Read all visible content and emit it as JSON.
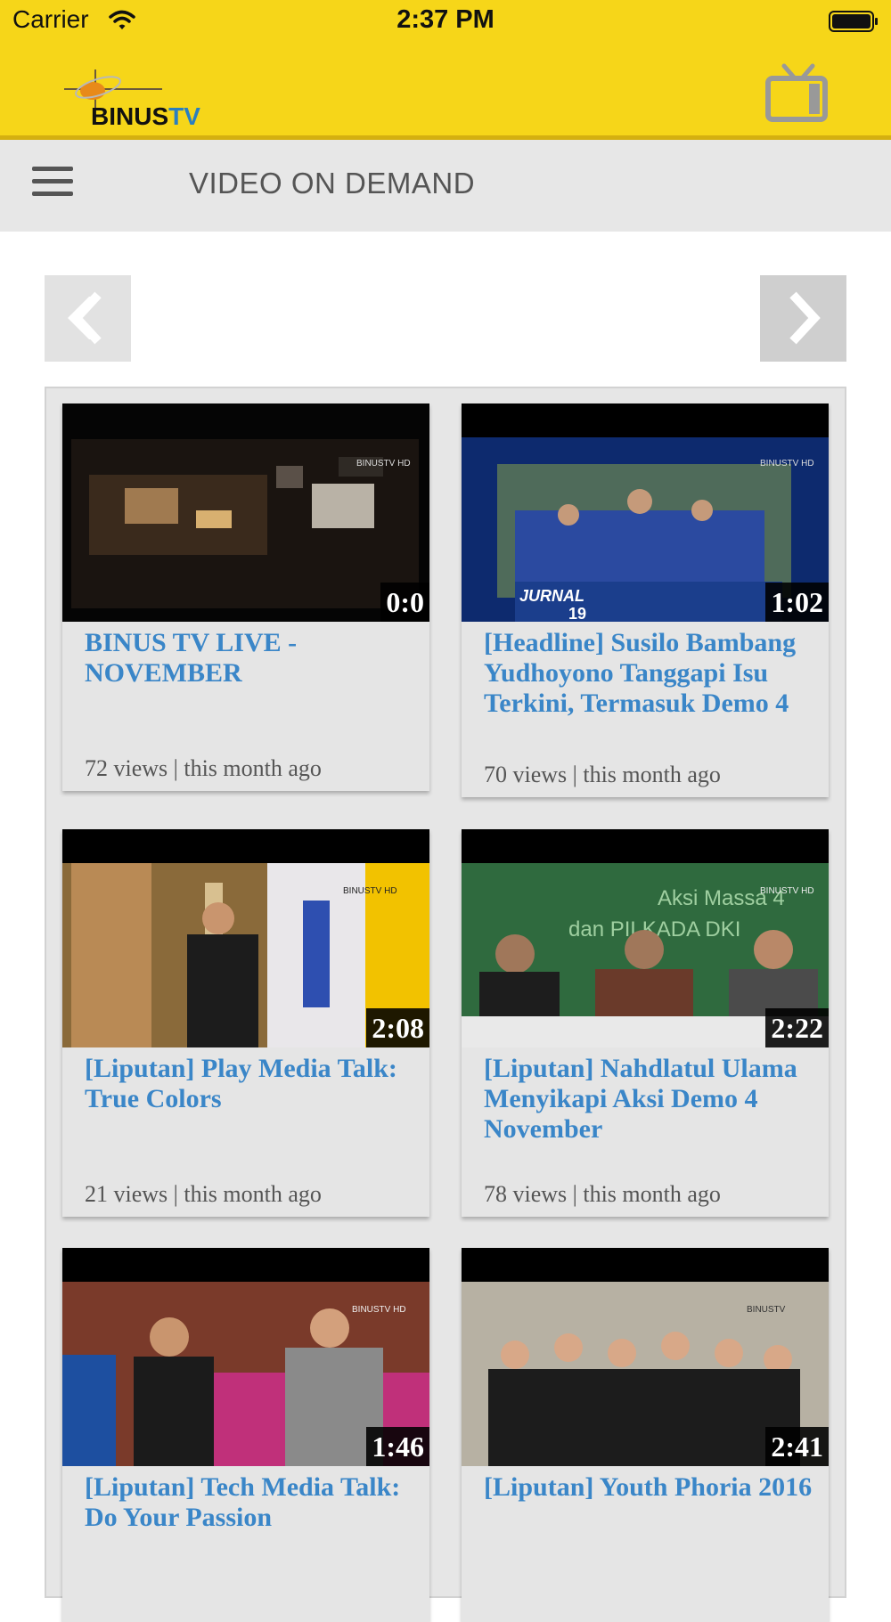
{
  "status_bar": {
    "carrier": "Carrier",
    "time": "2:37 PM"
  },
  "header": {
    "logo_text": "BINUSTV",
    "logo_text_a": "BINUS",
    "logo_text_b": "TV"
  },
  "nav": {
    "title": "VIDEO ON DEMAND"
  },
  "colors": {
    "header_bg": "#f6d619",
    "title_link": "#3a86c8",
    "nav_bg": "#e7e7e7"
  },
  "videos": [
    {
      "title": "BINUS TV LIVE - NOVEMBER",
      "duration": "0:0",
      "meta": "72 views | this month ago"
    },
    {
      "title": "[Headline] Susilo Bambang Yudhoyono Tanggapi Isu Terkini, Termasuk Demo 4",
      "duration": "1:02",
      "meta": "70 views | this month ago"
    },
    {
      "title": "[Liputan] Play Media Talk: True Colors",
      "duration": "2:08",
      "meta": "21 views | this month ago"
    },
    {
      "title": "[Liputan] Nahdlatul Ulama Menyikapi Aksi Demo 4 November",
      "duration": "2:22",
      "meta": "78 views | this month ago"
    },
    {
      "title": "[Liputan] Tech Media Talk: Do Your Passion",
      "duration": "1:46",
      "meta": ""
    },
    {
      "title": "[Liputan] Youth Phoria 2016",
      "duration": "2:41",
      "meta": ""
    }
  ]
}
